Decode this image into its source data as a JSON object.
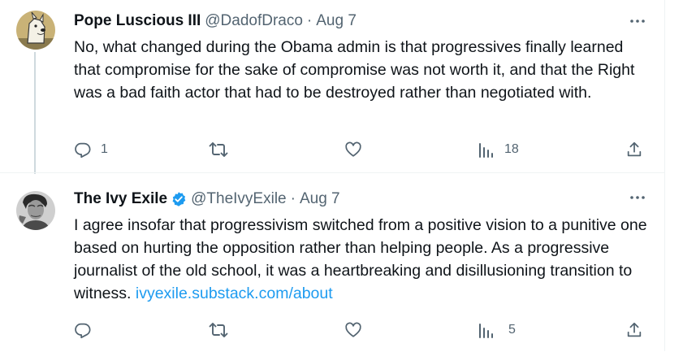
{
  "tweets": [
    {
      "display_name": "Pope Luscious III",
      "handle": "@DadofDraco",
      "separator": "·",
      "date": "Aug 7",
      "text": "No, what changed during the Obama admin is that progressives finally learned that compromise for the sake of compromise was not worth it, and that the Right was a bad faith actor that had to be destroyed rather than negotiated with.",
      "link": "",
      "replies": "1",
      "retweets": "",
      "likes": "",
      "views": "18",
      "verified": false,
      "avatar_icon": "cartoon-dog-avatar"
    },
    {
      "display_name": "The Ivy Exile",
      "handle": "@TheIvyExile",
      "separator": "·",
      "date": "Aug 7",
      "text": "I agree insofar that progressivism switched from a positive vision to a punitive one based on hurting the opposition rather than helping people. As a progressive journalist of the old school, it was a heartbreaking and disillusioning transition to witness.",
      "link": "ivyexile.substack.com/about",
      "replies": "",
      "retweets": "",
      "likes": "",
      "views": "5",
      "verified": true,
      "avatar_icon": "black-and-white-portrait-avatar"
    }
  ],
  "colors": {
    "text": "#0f1419",
    "secondary": "#536471",
    "link": "#1d9bf0",
    "thread_line": "#cfd9de",
    "verified": "#1d9bf0"
  },
  "icons": [
    "reply-icon",
    "retweet-icon",
    "like-icon",
    "views-icon",
    "share-icon",
    "more-icon",
    "verified-badge-icon"
  ]
}
